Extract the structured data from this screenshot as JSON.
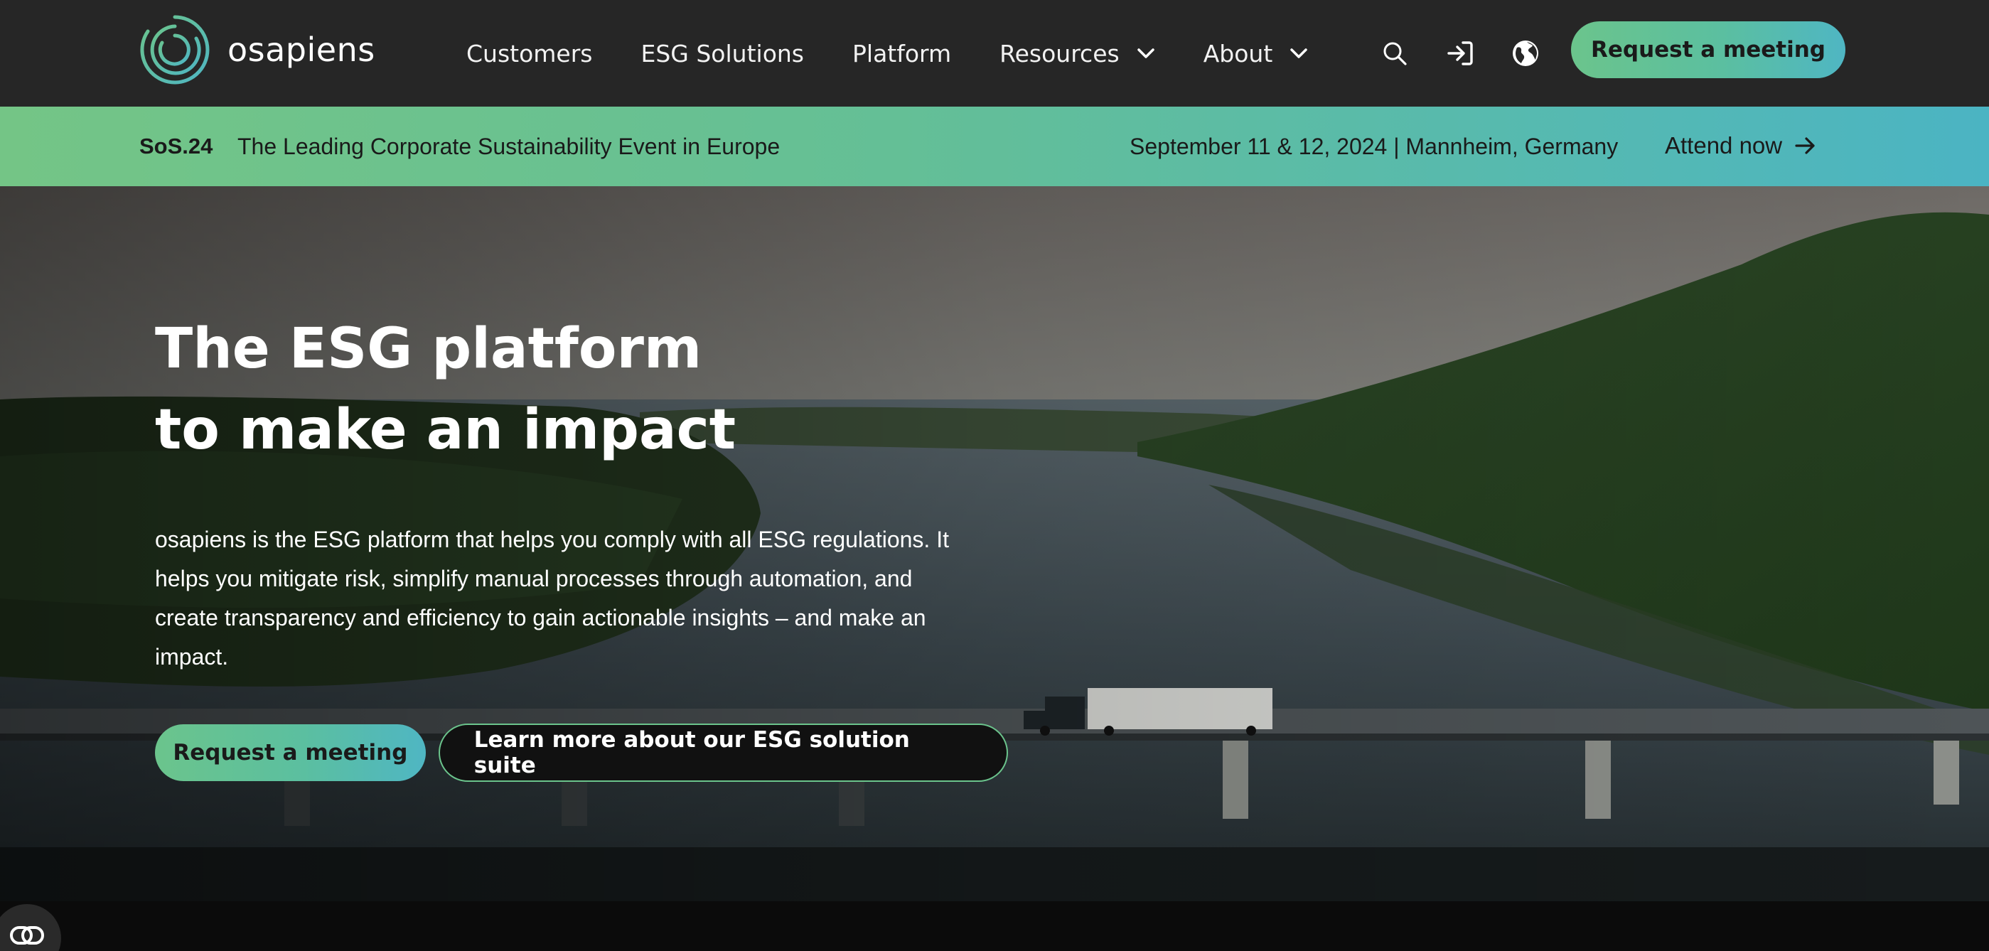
{
  "brand": {
    "name": "osapiens"
  },
  "nav": {
    "links": [
      {
        "label": "Customers",
        "has_dropdown": false
      },
      {
        "label": "ESG Solutions",
        "has_dropdown": false
      },
      {
        "label": "Platform",
        "has_dropdown": false
      },
      {
        "label": "Resources",
        "has_dropdown": true
      },
      {
        "label": "About",
        "has_dropdown": true
      }
    ],
    "icons": [
      "search-icon",
      "sign-in-icon",
      "globe-icon"
    ],
    "cta": "Request a meeting"
  },
  "banner": {
    "tag": "SoS.24",
    "headline": "The Leading Corporate Sustainability Event in Europe",
    "date": "September 11 & 12, 2024 | Mannheim, Germany",
    "cta": "Attend now"
  },
  "hero": {
    "title": "The ESG platform\nto make an impact",
    "description": "osapiens is the ESG platform that helps you comply with all ESG regulations. It helps you mitigate risk, simplify manual processes through automation, and create transparency and efficiency to gain actionable insights – and make an impact.",
    "primary_cta": "Request a meeting",
    "secondary_cta": "Learn more about our ESG solution suite"
  },
  "colors": {
    "nav_bg": "#262626",
    "accent_gradient_start": "#6bc48c",
    "accent_gradient_end": "#4fb6c3",
    "hero_text": "#ffffff"
  }
}
